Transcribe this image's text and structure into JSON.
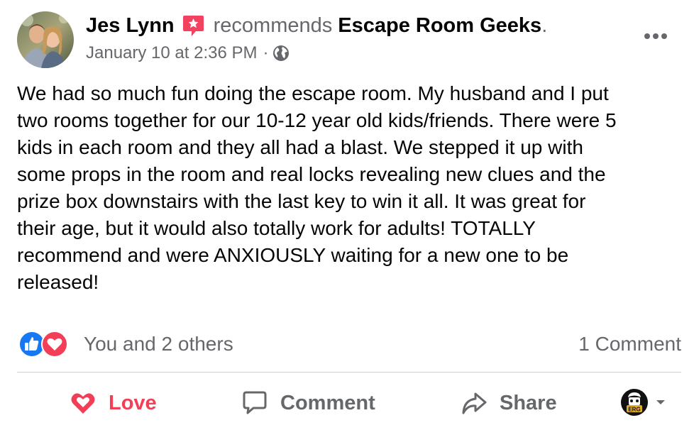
{
  "post": {
    "author": "Jes Lynn",
    "verb": "recommends",
    "page": "Escape Room Geeks",
    "period": ".",
    "timestamp": "January 10 at 2:36 PM",
    "separator": "·",
    "privacy_icon": "globe-icon",
    "badge_icon": "recommendation-star-icon",
    "more_icon": "more-options-icon",
    "body": "We had so much fun doing the escape room. My husband and I put\ntwo rooms together for our 10-12 year old kids/friends. There were 5\nkids in each room and they all had a blast. We stepped it up with\nsome props in the room and real locks revealing new clues and the\nprize box downstairs with the last key to win it all. It was great for\ntheir age, but it would also totally work for adults! TOTALLY\nrecommend and were ANXIOUSLY waiting for a new one to be\nreleased!"
  },
  "engagement": {
    "reactions_text": "You and 2 others",
    "reaction_icons": [
      "like-reaction-icon",
      "love-reaction-icon"
    ],
    "comments_text": "1 Comment"
  },
  "actions": {
    "love_label": "Love",
    "comment_label": "Comment",
    "share_label": "Share",
    "love_icon": "heart-icon",
    "comment_icon": "speech-bubble-icon",
    "share_icon": "share-arrow-icon",
    "profile_menu_icon": "chevron-down-icon",
    "profile_avatar_text": "ERG"
  },
  "colors": {
    "text": "#050505",
    "secondary": "#65676b",
    "love": "#f33e58",
    "like": "#1877f2",
    "badge": "#f3425f",
    "divider": "#ced0d4"
  }
}
